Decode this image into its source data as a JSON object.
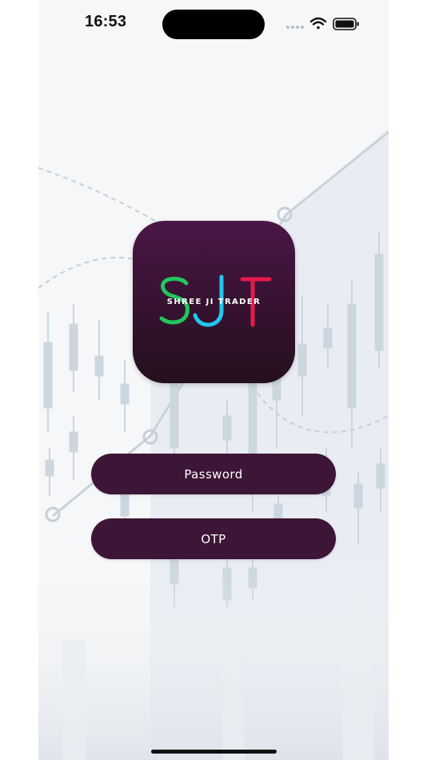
{
  "status_bar": {
    "time": "16:53",
    "icons": [
      "signal-dots-icon",
      "wifi-icon",
      "battery-icon"
    ]
  },
  "logo": {
    "letters": [
      "S",
      "J",
      "T"
    ],
    "letter_colors": [
      "#22c55e",
      "#22c8f0",
      "#e8194a"
    ],
    "tagline": "SHREE JI TRADER"
  },
  "actions": {
    "password_label": "Password",
    "otp_label": "OTP"
  },
  "theme": {
    "button_color": "#3d1536",
    "icon_gradient_top": "#4b1646",
    "icon_gradient_bottom": "#24101f"
  }
}
